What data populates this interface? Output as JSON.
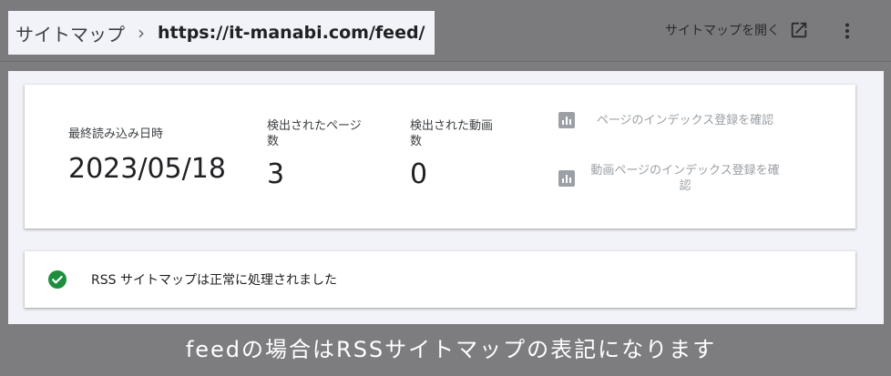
{
  "header": {
    "breadcrumb_root": "サイトマップ",
    "breadcrumb_separator": "›",
    "breadcrumb_current": "https://it-manabi.com/feed/",
    "open_sitemap_label": "サイトマップを開く",
    "open_icon": "open-in-new-icon",
    "more_icon": "more-vert-icon"
  },
  "stats": {
    "last_read": {
      "label": "最終読み込み日時",
      "value": "2023/05/18"
    },
    "pages_found": {
      "label": "検出されたページ数",
      "value": "3"
    },
    "videos_found": {
      "label": "検出された動画数",
      "value": "0"
    }
  },
  "actions": [
    {
      "label": "ページのインデックス登録を確認",
      "icon": "bar-chart-icon"
    },
    {
      "label": "動画ページのインデックス登録を確認",
      "icon": "bar-chart-icon"
    }
  ],
  "status": {
    "text": "RSS サイトマップは正常に処理されました",
    "icon": "check-circle-icon",
    "color": "#1e8e3e"
  },
  "caption": "feedの場合はRSSサイトマップの表記になります"
}
